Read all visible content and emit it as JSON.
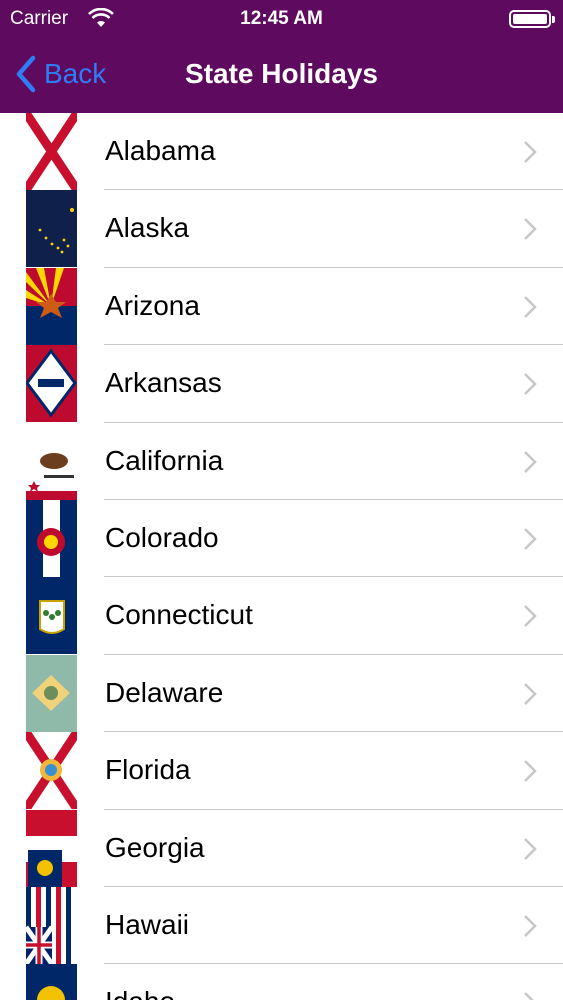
{
  "status_bar": {
    "carrier": "Carrier",
    "time": "12:45 AM"
  },
  "nav": {
    "back_label": "Back",
    "title": "State Holidays"
  },
  "colors": {
    "nav_background": "#5e0a5e",
    "back_tint": "#2f7df6",
    "disclosure": "#c7c7cc",
    "separator": "#c8c7cc"
  },
  "states": [
    {
      "name": "Alabama",
      "flag_icon": "alabama-flag-icon"
    },
    {
      "name": "Alaska",
      "flag_icon": "alaska-flag-icon"
    },
    {
      "name": "Arizona",
      "flag_icon": "arizona-flag-icon"
    },
    {
      "name": "Arkansas",
      "flag_icon": "arkansas-flag-icon"
    },
    {
      "name": "California",
      "flag_icon": "california-flag-icon"
    },
    {
      "name": "Colorado",
      "flag_icon": "colorado-flag-icon"
    },
    {
      "name": "Connecticut",
      "flag_icon": "connecticut-flag-icon"
    },
    {
      "name": "Delaware",
      "flag_icon": "delaware-flag-icon"
    },
    {
      "name": "Florida",
      "flag_icon": "florida-flag-icon"
    },
    {
      "name": "Georgia",
      "flag_icon": "georgia-flag-icon"
    },
    {
      "name": "Hawaii",
      "flag_icon": "hawaii-flag-icon"
    },
    {
      "name": "Idaho",
      "flag_icon": "idaho-flag-icon"
    }
  ]
}
